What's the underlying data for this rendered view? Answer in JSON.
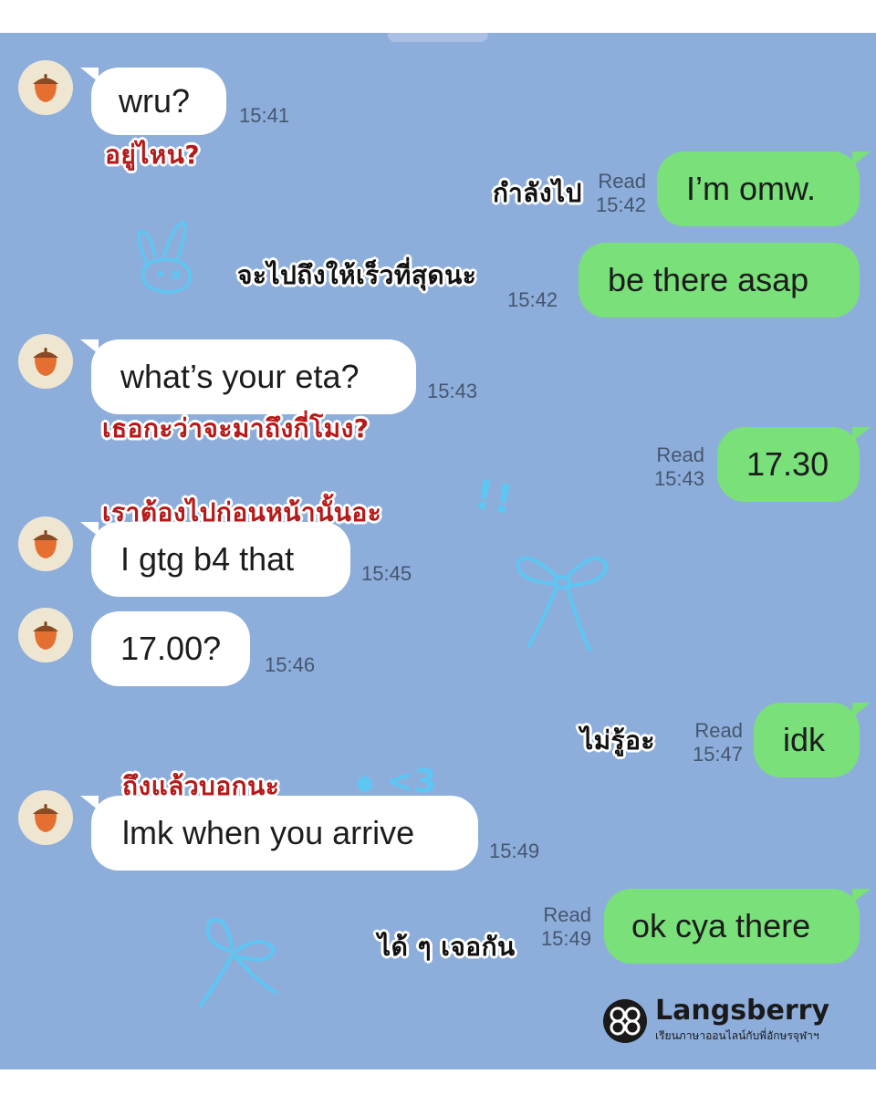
{
  "brand": {
    "name": "Langsberry",
    "tagline": "เรียนภาษาออนไลน์กับพี่อักษรจุฬาฯ"
  },
  "messages": [
    {
      "id": "m1",
      "side": "incoming",
      "text": "wru?",
      "time": "15:41",
      "translation": "อยู่ไหน?"
    },
    {
      "id": "m2",
      "side": "outgoing",
      "text": "I’m omw.",
      "status": "Read",
      "time": "15:42",
      "translation": "กำลังไป"
    },
    {
      "id": "m3",
      "side": "outgoing",
      "text": "be there asap",
      "time": "15:42",
      "translation": "จะไปถึงให้เร็วที่สุดนะ"
    },
    {
      "id": "m4",
      "side": "incoming",
      "text": "what’s your eta?",
      "time": "15:43",
      "translation": "เธอกะว่าจะมาถึงกี่โมง?"
    },
    {
      "id": "m5",
      "side": "outgoing",
      "text": "17.30",
      "status": "Read",
      "time": "15:43"
    },
    {
      "id": "m6",
      "side": "incoming",
      "text": "I gtg b4 that",
      "time": "15:45",
      "translation": "เราต้องไปก่อนหน้านั้นอะ"
    },
    {
      "id": "m7",
      "side": "incoming",
      "text": "17.00?",
      "time": "15:46"
    },
    {
      "id": "m8",
      "side": "outgoing",
      "text": "idk",
      "status": "Read",
      "time": "15:47",
      "translation": "ไม่รู้อะ"
    },
    {
      "id": "m9",
      "side": "incoming",
      "text": "lmk when you arrive",
      "time": "15:49",
      "translation": "ถึงแล้วบอกนะ"
    },
    {
      "id": "m10",
      "side": "outgoing",
      "text": "ok cya there",
      "status": "Read",
      "time": "15:49",
      "translation": "ได้ ๆ เจอกัน"
    }
  ],
  "doodles": {
    "heart_text": "<3",
    "exclaim_text": "!!"
  },
  "colors": {
    "chat_background": "#8daedb",
    "incoming_bubble": "#ffffff",
    "outgoing_bubble": "#79e07a",
    "translation_red": "#b51919",
    "doodle_blue": "#5ec6f2"
  },
  "icons": {
    "avatar": "acorn-icon",
    "logo": "langsberry-logo-icon"
  }
}
